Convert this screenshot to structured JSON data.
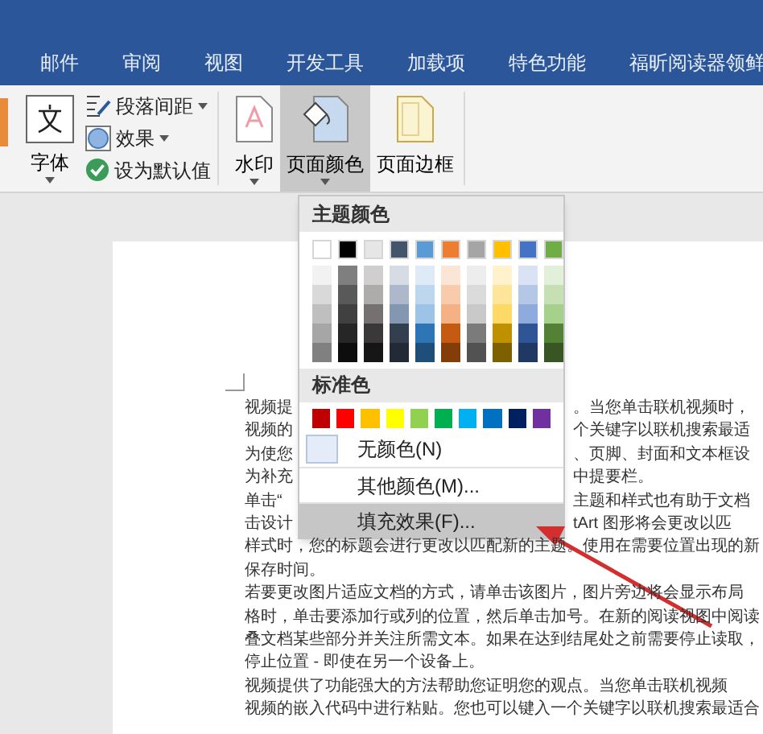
{
  "tabs": [
    {
      "label": "邮件",
      "selected": false
    },
    {
      "label": "审阅",
      "selected": false
    },
    {
      "label": "视图",
      "selected": false
    },
    {
      "label": "开发工具",
      "selected": false
    },
    {
      "label": "加载项",
      "selected": false
    },
    {
      "label": "特色功能",
      "selected": false
    },
    {
      "label": "福昕阅读器领鲜",
      "selected": false
    }
  ],
  "ribbon": {
    "fonts_button": "字体",
    "small_buttons": [
      {
        "label": "段落间距",
        "caret": true
      },
      {
        "label": "效果",
        "caret": true
      },
      {
        "label": "设为默认值",
        "caret": false
      }
    ],
    "large_buttons": [
      {
        "label": "水印",
        "caret": true,
        "selected": false,
        "kind": "watermark"
      },
      {
        "label": "页面颜色",
        "caret": true,
        "selected": true,
        "kind": "page-color"
      },
      {
        "label": "页面边框",
        "caret": false,
        "selected": false,
        "kind": "page-border"
      }
    ]
  },
  "menu": {
    "theme_header": "主题颜色",
    "theme_colors": [
      {
        "color": "#ffffff",
        "shades": [
          {
            "color": "#f2f2f2"
          },
          {
            "color": "#d9d9d9"
          },
          {
            "color": "#bfbfbf"
          },
          {
            "color": "#a6a6a6"
          },
          {
            "color": "#808080"
          }
        ]
      },
      {
        "color": "#000000",
        "shades": [
          {
            "color": "#7f7f7f"
          },
          {
            "color": "#595959"
          },
          {
            "color": "#404040"
          },
          {
            "color": "#262626"
          },
          {
            "color": "#0d0d0d"
          }
        ]
      },
      {
        "color": "#e7e6e6",
        "shades": [
          {
            "color": "#d0cece"
          },
          {
            "color": "#aeabab"
          },
          {
            "color": "#757171"
          },
          {
            "color": "#3a3838"
          },
          {
            "color": "#171616"
          }
        ]
      },
      {
        "color": "#44546a",
        "shades": [
          {
            "color": "#d6dce4"
          },
          {
            "color": "#adb9ca"
          },
          {
            "color": "#8497b0"
          },
          {
            "color": "#333f4f"
          },
          {
            "color": "#222a35"
          }
        ]
      },
      {
        "color": "#5b9bd5",
        "shades": [
          {
            "color": "#deebf6"
          },
          {
            "color": "#bdd7ee"
          },
          {
            "color": "#9dc3e6"
          },
          {
            "color": "#2e75b5"
          },
          {
            "color": "#1f4e79"
          }
        ]
      },
      {
        "color": "#ed7d31",
        "shades": [
          {
            "color": "#fbe5d5"
          },
          {
            "color": "#f7cbac"
          },
          {
            "color": "#f4b183"
          },
          {
            "color": "#c55a11"
          },
          {
            "color": "#843c0b"
          }
        ]
      },
      {
        "color": "#a5a5a5",
        "shades": [
          {
            "color": "#ededed"
          },
          {
            "color": "#dbdbdb"
          },
          {
            "color": "#c9c9c9"
          },
          {
            "color": "#7b7b7b"
          },
          {
            "color": "#525252"
          }
        ]
      },
      {
        "color": "#ffc000",
        "shades": [
          {
            "color": "#fff2cc"
          },
          {
            "color": "#fee599"
          },
          {
            "color": "#ffd965"
          },
          {
            "color": "#bf9000"
          },
          {
            "color": "#7f6000"
          }
        ]
      },
      {
        "color": "#4472c4",
        "shades": [
          {
            "color": "#dae3f3"
          },
          {
            "color": "#b4c7e7"
          },
          {
            "color": "#8faadc"
          },
          {
            "color": "#2f5597"
          },
          {
            "color": "#203864"
          }
        ]
      },
      {
        "color": "#70ad47",
        "shades": [
          {
            "color": "#e2efd9"
          },
          {
            "color": "#c5e0b3"
          },
          {
            "color": "#a8d08d"
          },
          {
            "color": "#538135"
          },
          {
            "color": "#375623"
          }
        ]
      }
    ],
    "standard_header": "标准色",
    "standard_colors": [
      {
        "color": "#c00000"
      },
      {
        "color": "#ff0000"
      },
      {
        "color": "#ffc000"
      },
      {
        "color": "#ffff00"
      },
      {
        "color": "#92d050"
      },
      {
        "color": "#00b050"
      },
      {
        "color": "#00b0f0"
      },
      {
        "color": "#0070c0"
      },
      {
        "color": "#002060"
      },
      {
        "color": "#7030a0"
      }
    ],
    "items": [
      {
        "label": "无颜色(N)",
        "kind": "no-color",
        "selected": false
      },
      {
        "label": "其他颜色(M)...",
        "kind": "more",
        "selected": false
      },
      {
        "label": "填充效果(F)...",
        "kind": "fill",
        "selected": true
      }
    ]
  },
  "document": {
    "lines": [
      {
        "left": "视频提",
        "right": "。当您单击联机视频时，"
      },
      {
        "left": "视频的",
        "right": "个关键字以联机搜索最适"
      },
      {
        "left": "为使您",
        "right": "、页脚、封面和文本框设"
      },
      {
        "left": "为补充",
        "right": "中提要栏。"
      },
      {
        "left": "单击“",
        "right": "主题和样式也有助于文档"
      },
      {
        "left": "击设计",
        "right": "tArt 图形将会更改以匹"
      },
      {
        "left": "样式时，您的标题会进行更改以匹配新的主题。使用在需要位置出现的新"
      },
      {
        "left": "保存时间。"
      },
      {
        "left": "若要更改图片适应文档的方式，请单击该图片，图片旁边将会显示布局"
      },
      {
        "left": "格时，单击要添加行或列的位置，然后单击加号。在新的阅读视图中阅读"
      },
      {
        "left": "叠文档某些部分并关注所需文本。如果在达到结尾处之前需要停止读取，"
      },
      {
        "left": "停止位置 - 即使在另一个设备上。"
      },
      {
        "left": "视频提供了功能强大的方法帮助您证明您的观点。当您单击联机视频"
      },
      {
        "left": "视频的嵌入代码中进行粘贴。您也可以键入一个关键字以联机搜索最适合"
      }
    ]
  }
}
